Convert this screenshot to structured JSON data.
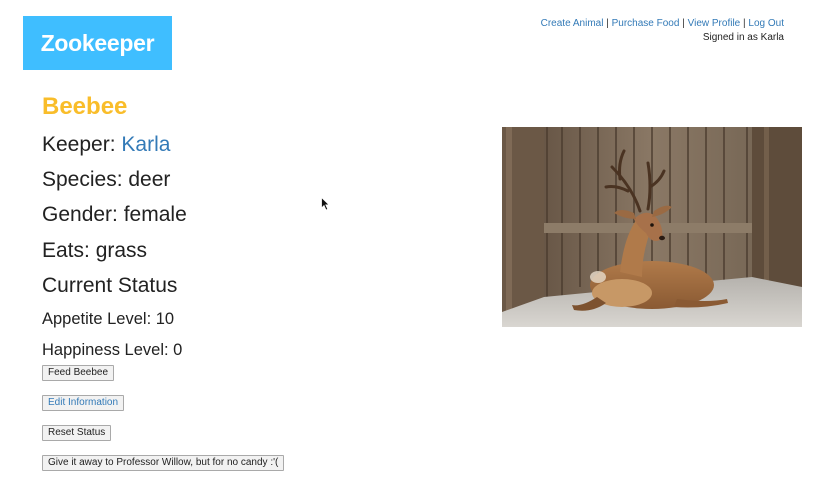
{
  "header": {
    "logo_text": "Zookeeper",
    "nav": {
      "create_animal": "Create Animal",
      "purchase_food": "Purchase Food",
      "view_profile": "View Profile",
      "log_out": "Log Out",
      "separator": "|"
    },
    "signed_in": "Signed in as Karla"
  },
  "animal": {
    "name": "Beebee",
    "keeper_label": "Keeper: ",
    "keeper_name": "Karla",
    "species": "Species: deer",
    "gender": "Gender: female",
    "eats": "Eats: grass",
    "status_heading": "Current Status",
    "appetite": "Appetite Level: 10",
    "happiness": "Happiness Level: 0",
    "photo_subject": "deer resting in wooden stable"
  },
  "actions": {
    "feed": "Feed Beebee",
    "edit": "Edit Information",
    "reset": "Reset Status",
    "give_away": "Give it away to Professor Willow, but for no candy :'("
  },
  "colors": {
    "logo_bg": "#3fbeff",
    "name": "#f9bd2a",
    "link": "#337ab7"
  }
}
